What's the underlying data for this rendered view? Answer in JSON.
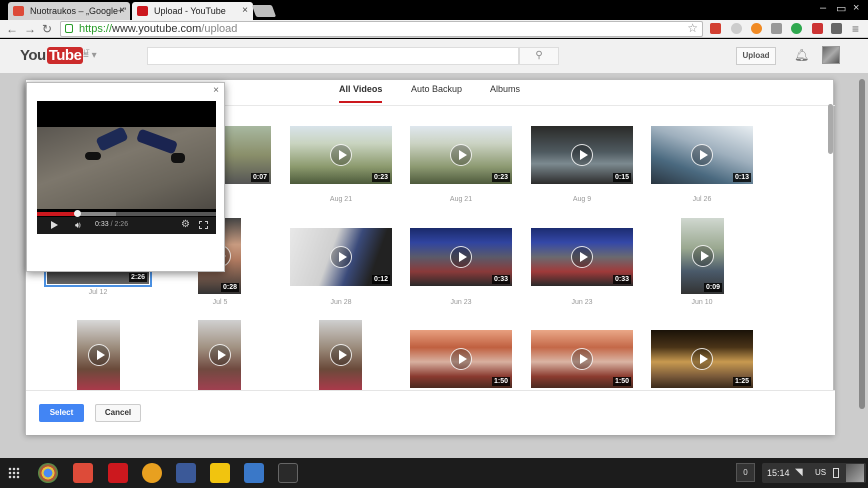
{
  "browser": {
    "tabs": [
      {
        "title": "Nuotraukos – „Google+“",
        "favicon_color": "#dd4b39",
        "active": false
      },
      {
        "title": "Upload - YouTube",
        "favicon_color": "#cc181e",
        "active": true
      }
    ],
    "url": {
      "scheme": "https://",
      "host": "www.youtube.com",
      "path": "/upload"
    }
  },
  "youtube": {
    "logo": {
      "you": "You",
      "tube": "Tube",
      "country": "LT"
    },
    "upload_label": "Upload"
  },
  "picker": {
    "tabs": [
      {
        "label": "All Videos",
        "active": true
      },
      {
        "label": "Auto Backup",
        "active": false
      },
      {
        "label": "Albums",
        "active": false
      }
    ],
    "videos": [
      {
        "duration": "2:26",
        "date": "Jul 12",
        "selected": true
      },
      {
        "duration": "0:07",
        "date": "Aug 21",
        "selected": false
      },
      {
        "duration": "0:23",
        "date": "Aug 21",
        "selected": false
      },
      {
        "duration": "0:23",
        "date": "Aug 21",
        "selected": false
      },
      {
        "duration": "0:15",
        "date": "Aug 9",
        "selected": false
      },
      {
        "duration": "0:13",
        "date": "Jul 26",
        "selected": false
      },
      {
        "duration": "0:28",
        "date": "Jul 5",
        "selected": false
      },
      {
        "duration": "0:12",
        "date": "Jun 28",
        "selected": false
      },
      {
        "duration": "0:33",
        "date": "Jun 23",
        "selected": false
      },
      {
        "duration": "0:33",
        "date": "Jun 23",
        "selected": false
      },
      {
        "duration": "0:09",
        "date": "Jun 10",
        "selected": false
      },
      {
        "duration": "",
        "date": "",
        "selected": false
      },
      {
        "duration": "",
        "date": "",
        "selected": false
      },
      {
        "duration": "",
        "date": "",
        "selected": false
      },
      {
        "duration": "1:50",
        "date": "",
        "selected": false
      },
      {
        "duration": "1:50",
        "date": "",
        "selected": false
      },
      {
        "duration": "1:25",
        "date": "",
        "selected": false
      }
    ],
    "select_label": "Select",
    "cancel_label": "Cancel"
  },
  "preview": {
    "close_glyph": "×",
    "current_time": "0:33",
    "total_time": "2:26",
    "played_fraction": 0.226
  },
  "taskbar": {
    "notification_count": "0",
    "time": "15:14",
    "keyboard": "US"
  }
}
